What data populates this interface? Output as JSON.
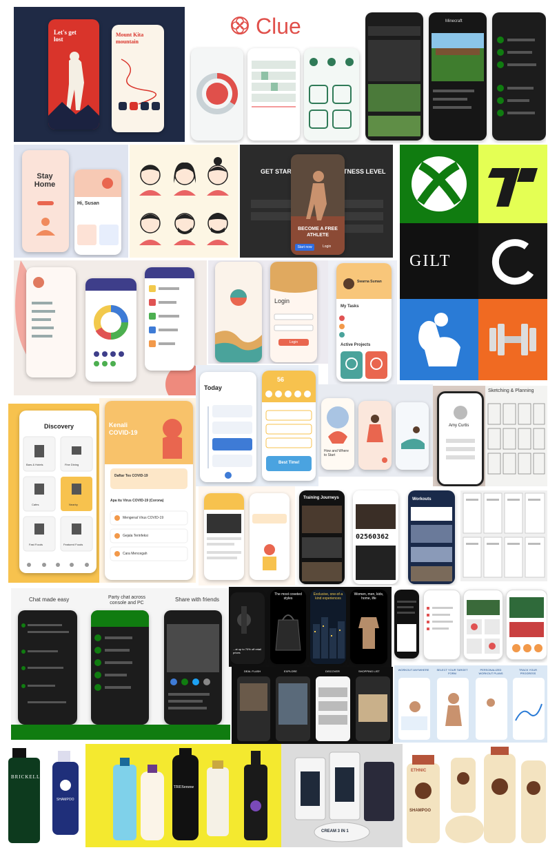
{
  "tiles": {
    "red_onboarding": {
      "headline": "Let's get lost",
      "card_title": "Mount Kita mountain"
    },
    "clue": {
      "brand": "Clue",
      "accent": "#e0504b"
    },
    "minecraft": {
      "title": "Minecraft"
    },
    "stay_home": {
      "title": "Stay Home",
      "greeting": "Hi, Susan"
    },
    "athlete": {
      "left_heading": "GET STARTE",
      "right_heading": "TNESS LEVEL",
      "promo": "BECOME A FREE ATHLETE",
      "cta": "Start now",
      "login": "Login"
    },
    "app_icons": {
      "gilt": "GILT",
      "xbox_color": "#107c10",
      "onefootball_bg": "#e4ff54",
      "fitness_bg": "#2a7bd6",
      "dumbbell_bg": "#f06a22"
    },
    "login_app": {
      "title": "Login",
      "button": "Login"
    },
    "tasks": {
      "user": "Swarna Suman",
      "section1": "My Tasks",
      "section2": "Active Projects"
    },
    "discovery": {
      "title": "Discovery",
      "items": [
        "Bars & Hotels",
        "Fine Dining",
        "Cafes",
        "Nearby",
        "Fast Foods",
        "Featured Foods"
      ]
    },
    "covid": {
      "title": "Kenali COVID-19",
      "card": "Daftar Tes COVID-19",
      "question": "Apa itu Virus COVID-19 (Corona)",
      "list": [
        "Mengenal Virus COVID-19",
        "Gejala Terinfeksi",
        "Cara Mencegah"
      ]
    },
    "today": {
      "title": "Today",
      "badge": "56",
      "best": "Best Time!"
    },
    "walkthrough": {
      "caption": "How and Where to Start"
    },
    "sketch": {
      "title": "Sketching & Planning"
    },
    "profile": {
      "name": "Amy Curtis"
    },
    "training": {
      "title": "Training Journeys",
      "counter": "02560362",
      "workouts": "Workouts"
    },
    "chat": {
      "screens": [
        "Chat made easy",
        "Party chat across console and PC",
        "Share with friends"
      ]
    },
    "fashion": {
      "headings": [
        "The most coveted styles",
        "Exclusive, one-of-a kind experiences",
        "Women, men, kids, home, life"
      ],
      "footer": "...at up to 70% off retail prices"
    },
    "shopping": {
      "screens": [
        "DEAL FLASH",
        "EXPLORE",
        "DISCOVER",
        "SHOPPING LIST"
      ]
    },
    "workout_plans": {
      "screens": [
        "WORKOUT ANYWHERE",
        "SELECT YOUR TARGET FORM",
        "PERSONALIZED WORKOUT PLANS",
        "TRACK YOUR PROGRESS"
      ]
    },
    "brickell": {
      "brand": "BRICKELL",
      "product": "SHAMPOO"
    },
    "shampoos": {
      "brand": "TRESemme",
      "bg": "#f4e92f"
    },
    "cream": {
      "product": "CREAM 3 IN 1"
    },
    "ethnic": {
      "brand": "ETHNIC",
      "product": "SHAMPOO"
    }
  }
}
